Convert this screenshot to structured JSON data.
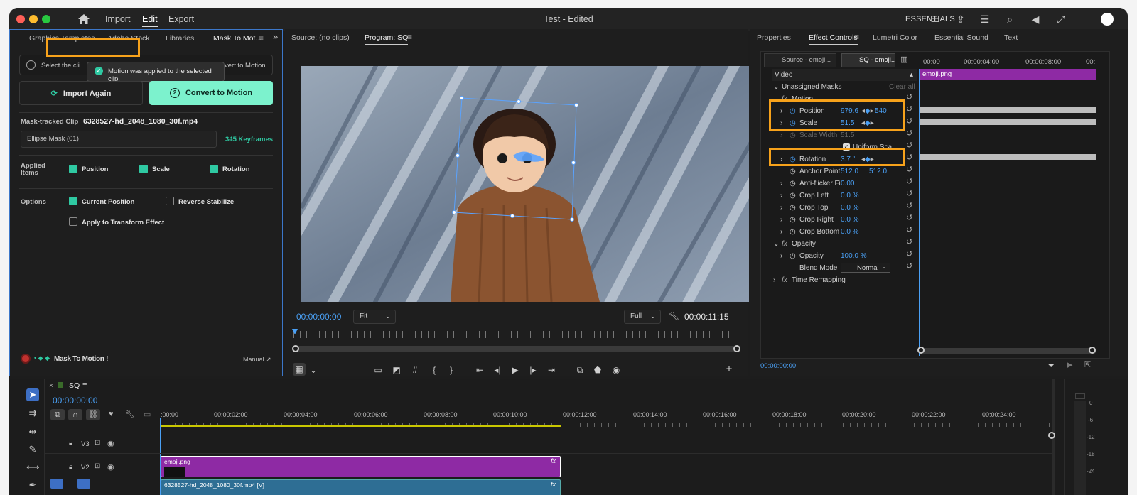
{
  "app": {
    "menu": [
      "Import",
      "Edit",
      "Export"
    ],
    "title": "Test - Edited",
    "workspace": "ESSENTIALS"
  },
  "left_panel": {
    "tabs": [
      "Graphics Templates",
      "Adobe Stock",
      "Libraries",
      "Mask To Mot..."
    ],
    "info_text": "Select the cli",
    "info_text_tail": "vert to Motion.",
    "tooltip": "Motion was applied to the selected clip.",
    "import_again": "Import Again",
    "convert_step": "2",
    "convert_to_motion": "Convert to Motion",
    "mask_clip_label": "Mask-tracked Clip",
    "mask_clip_value": "6328527-hd_2048_1080_30f.mp4",
    "mask_select": "Ellipse Mask (01)",
    "keyframes": "345 Keyframes",
    "applied_items_label": "Applied Items",
    "applied_items": [
      "Position",
      "Scale",
      "Rotation"
    ],
    "options_label": "Options",
    "options": {
      "current_position": "Current Position",
      "reverse_stabilize": "Reverse Stabilize",
      "apply_transform": "Apply to Transform Effect"
    },
    "brand": "Mask To Motion !",
    "manual": "Manual ↗"
  },
  "monitor": {
    "source_tab": "Source: (no clips)",
    "program_tab": "Program: SQ",
    "timecode": "00:00:00:00",
    "zoom": "Fit",
    "quality": "Full",
    "duration": "00:00:11:15"
  },
  "effect_controls": {
    "tabs": [
      "Properties",
      "Effect Controls",
      "Lumetri Color",
      "Essential Sound",
      "Text"
    ],
    "source_tab": "Source - emoji...",
    "sequence_tab": "SQ - emoji...",
    "ruler": [
      "00:00",
      "00:00:04:00",
      "00:00:08:00",
      "00:"
    ],
    "clip_name": "emoji.png",
    "video_label": "Video",
    "unassigned_masks": "Unassigned Masks",
    "clear_all": "Clear all",
    "motion": "Motion",
    "rows": [
      {
        "name": "Position",
        "value": "979.6",
        "value2": "540"
      },
      {
        "name": "Scale",
        "value": "51.5"
      },
      {
        "name": "Scale Width",
        "value": "51.5"
      },
      {
        "name": "Uniform Sca..."
      },
      {
        "name": "Rotation",
        "value": "3.7 °"
      },
      {
        "name": "Anchor Point",
        "value": "512.0",
        "value2": "512.0"
      },
      {
        "name": "Anti-flicker Fi...",
        "value": "0.00"
      },
      {
        "name": "Crop Left",
        "value": "0.0 %"
      },
      {
        "name": "Crop Top",
        "value": "0.0 %"
      },
      {
        "name": "Crop Right",
        "value": "0.0 %"
      },
      {
        "name": "Crop Bottom",
        "value": "0.0 %"
      }
    ],
    "opacity_group": "Opacity",
    "opacity": {
      "name": "Opacity",
      "value": "100.0 %"
    },
    "blend_mode": {
      "name": "Blend Mode",
      "value": "Normal"
    },
    "time_remapping": "Time Remapping",
    "timecode": "00:00:00:00"
  },
  "timeline": {
    "sequence": "SQ",
    "timecode": "00:00:00:00",
    "ruler": [
      ":00:00",
      "00:00:02:00",
      "00:00:04:00",
      "00:00:06:00",
      "00:00:08:00",
      "00:00:10:00",
      "00:00:12:00",
      "00:00:14:00",
      "00:00:16:00",
      "00:00:18:00",
      "00:00:20:00",
      "00:00:22:00",
      "00:00:24:00"
    ],
    "tracks": [
      "V3",
      "V2"
    ],
    "clip_v2": "emoji.png",
    "clip_v1": "6328527-hd_2048_1080_30f.mp4 [V]",
    "fx": "fx",
    "meter_scale": [
      "0",
      "-6",
      "-12",
      "-18",
      "-24"
    ]
  },
  "colors": {
    "accent_teal": "#2fc9a2",
    "highlight_orange": "#f7a21b",
    "timecode_blue": "#4aa0f5",
    "clip_purple": "#8e2aa4"
  }
}
